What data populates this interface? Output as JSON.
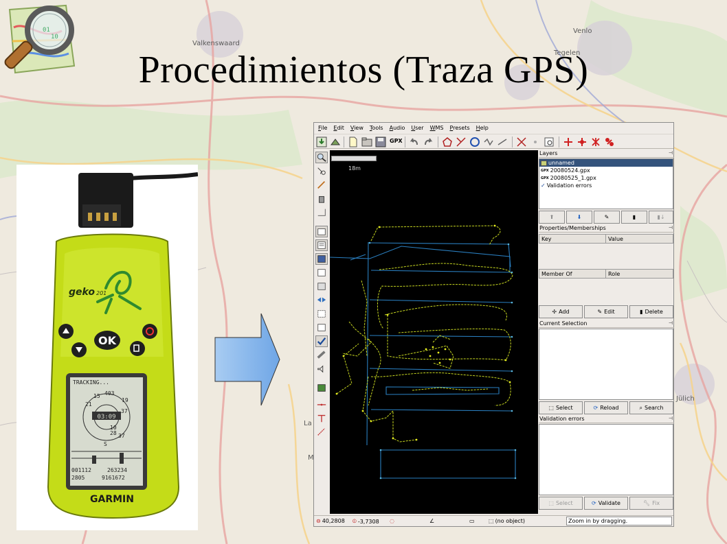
{
  "slide": {
    "title": "Procedimientos (Traza GPS)"
  },
  "map_labels": {
    "valkenswaard": "Valkenswaard",
    "venlo": "Venlo",
    "tegelen": "Tegelen",
    "julich": "Jülich",
    "la": "La",
    "m": "M"
  },
  "device": {
    "brand": "GARMIN",
    "model": "geko",
    "model_number": "201",
    "ok_label": "OK",
    "screen_title": "TRACKING...",
    "screen_time": "03:09",
    "ring_numbers": [
      "15",
      "403",
      "19",
      "21",
      "37",
      "10",
      "28",
      "37"
    ],
    "row1": "001112",
    "row1b": "263234",
    "row2": "2805",
    "row2b": "9161672",
    "south": "S"
  },
  "josm": {
    "menu": [
      "File",
      "Edit",
      "View",
      "Tools",
      "Audio",
      "User",
      "WMS",
      "Presets",
      "Help"
    ],
    "toolbar_gpx": "GPX",
    "scale": "18m",
    "layers": {
      "title": "Layers",
      "items": [
        {
          "label": "unnamed",
          "selected": true,
          "icon": "osm-layer-icon"
        },
        {
          "label": "20080524.gpx",
          "selected": false,
          "icon": "gpx-layer-icon"
        },
        {
          "label": "20080525_1.gpx",
          "selected": false,
          "icon": "gpx-layer-icon"
        },
        {
          "label": "Validation errors",
          "selected": false,
          "icon": "check-icon"
        }
      ]
    },
    "properties": {
      "title": "Properties/Memberships",
      "key": "Key",
      "value": "Value",
      "member_of": "Member Of",
      "role": "Role",
      "add": "Add",
      "edit": "Edit",
      "delete": "Delete"
    },
    "selection": {
      "title": "Current Selection",
      "select": "Select",
      "reload": "Reload",
      "search": "Search"
    },
    "validation": {
      "title": "Validation errors",
      "select": "Select",
      "validate": "Validate",
      "fix": "Fix"
    },
    "status": {
      "lat": "40,2808",
      "lon": "-3,7308",
      "object": "(no object)",
      "help": "Zoom in by dragging."
    }
  }
}
